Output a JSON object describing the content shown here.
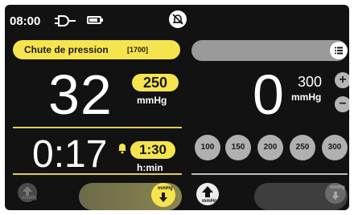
{
  "status": {
    "time": "08:00",
    "icons": [
      "plug-icon",
      "battery-icon",
      "alarm-muted-icon"
    ]
  },
  "alarm": {
    "title": "Chute de pression",
    "code": "[1700]",
    "color": "#f6e44f"
  },
  "left_panel": {
    "pressure_value": "32",
    "pressure_limit": "250",
    "pressure_unit": "mmHg",
    "time_value": "0:17",
    "time_limit": "1:30",
    "time_unit": "h:min",
    "slider_unit": "mmHg",
    "deflate_unit": "mmHg"
  },
  "right_panel": {
    "pressure_value": "0",
    "pressure_limit": "300",
    "pressure_unit": "mmHg",
    "presets": [
      "100",
      "150",
      "200",
      "250",
      "300"
    ],
    "deflate_unit": "mmHg",
    "slider_unit": "mmHg"
  }
}
